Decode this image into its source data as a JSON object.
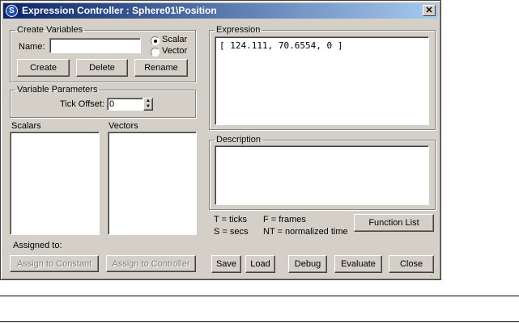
{
  "window": {
    "title": "Expression Controller : Sphere01\\Position",
    "icon": "app-logo-icon",
    "close_glyph": "✕"
  },
  "create_variables": {
    "legend": "Create Variables",
    "name_label": "Name:",
    "name_value": "",
    "radio_scalar": "Scalar",
    "radio_vector": "Vector",
    "selected": "Scalar",
    "create_btn": "Create",
    "delete_btn": "Delete",
    "rename_btn": "Rename"
  },
  "variable_parameters": {
    "legend": "Variable Parameters",
    "tick_offset_label": "Tick Offset:",
    "tick_offset_value": "0"
  },
  "lists": {
    "scalars_label": "Scalars",
    "vectors_label": "Vectors"
  },
  "assigned": {
    "label": "Assigned to:",
    "assign_constant": "Assign to Constant",
    "assign_controller": "Assign to Controller"
  },
  "expression": {
    "legend": "Expression",
    "text": "[ 124.111, 70.6554, 0 ]"
  },
  "description": {
    "legend": "Description",
    "text": ""
  },
  "legend_info": {
    "t": "T = ticks",
    "f": "F = frames",
    "s": "S = secs",
    "nt": "NT = normalized time"
  },
  "buttons": {
    "function_list": "Function List",
    "save": "Save",
    "load": "Load",
    "debug": "Debug",
    "evaluate": "Evaluate",
    "close": "Close"
  },
  "colors": {
    "face": "#d4d0c8",
    "titlebar_start": "#0a246a",
    "titlebar_end": "#a6caf0"
  }
}
